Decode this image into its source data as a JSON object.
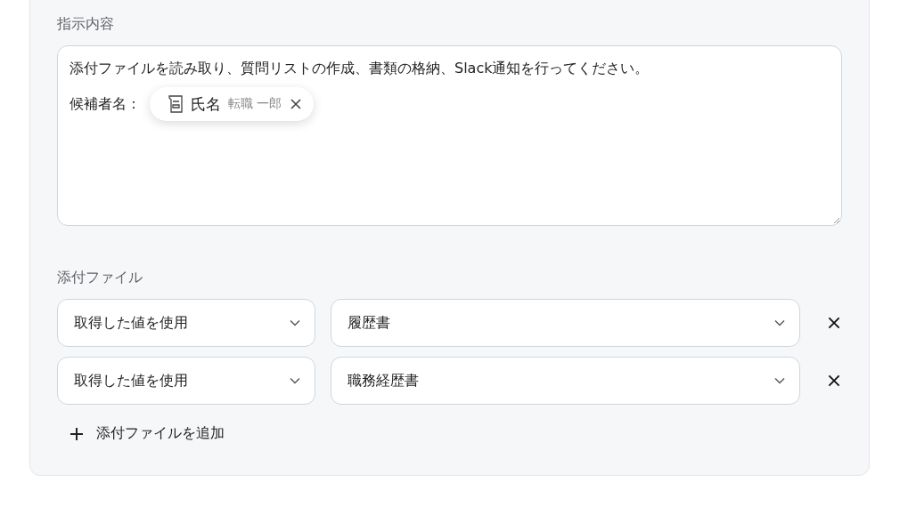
{
  "instruction": {
    "label": "指示内容",
    "text": "添付ファイルを読み取り、質問リストの作成、書類の格納、Slack通知を行ってください。",
    "prefix": "候補者名：",
    "chip": {
      "name": "氏名",
      "value": "転職 一郎"
    }
  },
  "attachments": {
    "label": "添付ファイル",
    "rows": [
      {
        "source": "取得した値を使用",
        "file": "履歴書"
      },
      {
        "source": "取得した値を使用",
        "file": "職務経歴書"
      }
    ],
    "add_button": "添付ファイルを追加"
  }
}
